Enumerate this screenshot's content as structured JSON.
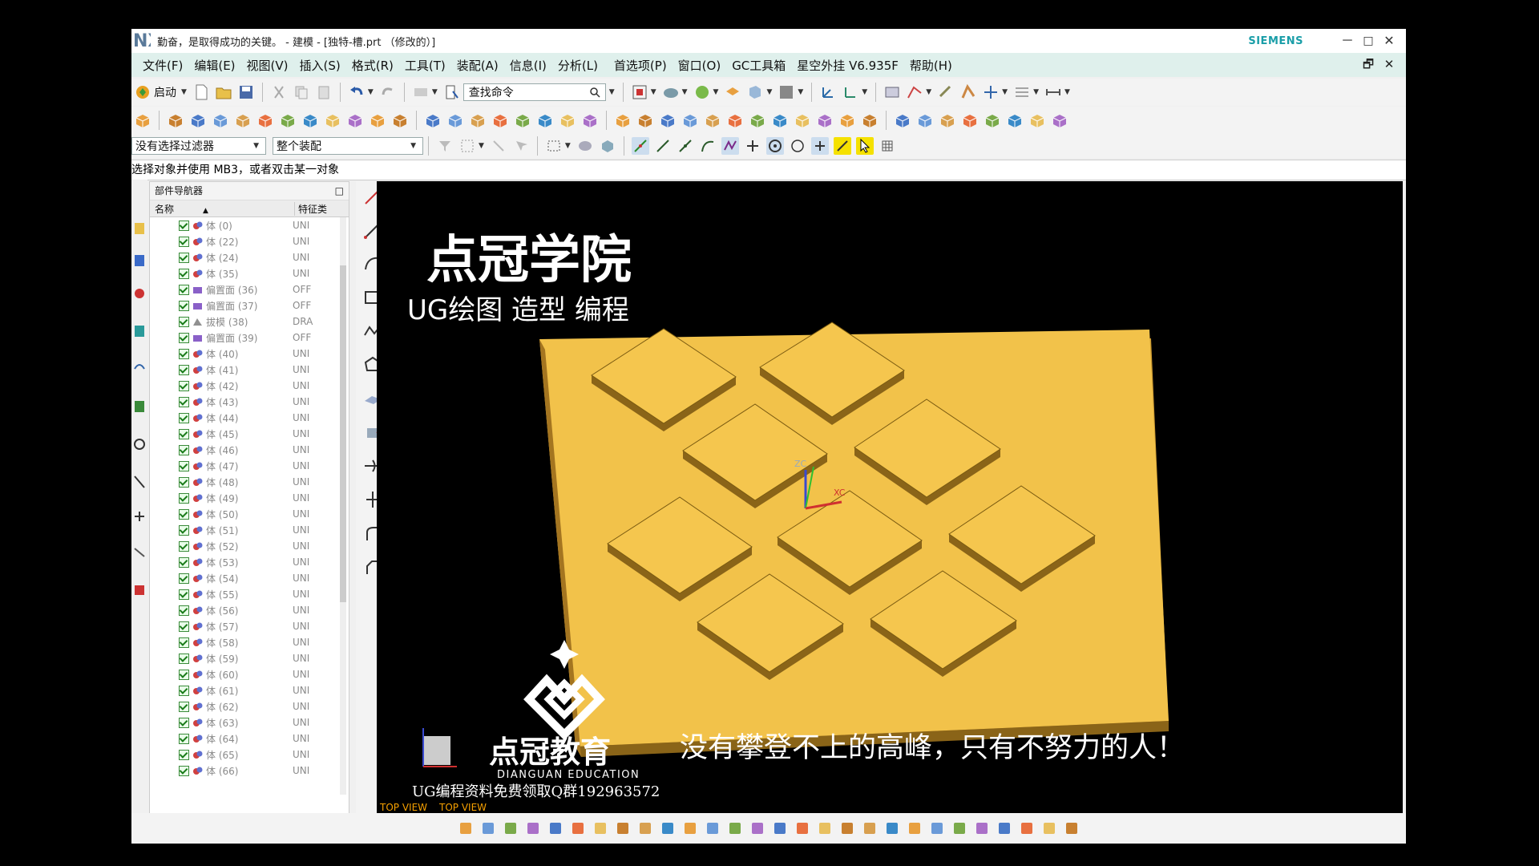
{
  "window": {
    "logo_text": "NX",
    "title": "勤奋，是取得成功的关键。 - 建模 - [独特-槽.prt （修改的）]",
    "brand": "SIEMENS",
    "minimize": "－",
    "maximize": "□",
    "close": "✕"
  },
  "menubar": {
    "items": [
      "文件(F)",
      "编辑(E)",
      "视图(V)",
      "插入(S)",
      "格式(R)",
      "工具(T)",
      "装配(A)",
      "信息(I)",
      "分析(L)",
      "首选项(P)",
      "窗口(O)",
      "GC工具箱",
      "星空外挂 V6.935F",
      "帮助(H)"
    ],
    "restore": "🗗",
    "close": "✕"
  },
  "toolbar": {
    "start_label": "启动",
    "search_placeholder": "查找命令",
    "filter_value": "没有选择过滤器",
    "scope_value": "整个装配"
  },
  "status": {
    "prompt": "选择对象并使用 MB3，或者双击某一对象"
  },
  "navigator": {
    "title": "部件导航器",
    "col_name": "名称",
    "col_type": "特征类",
    "rows": [
      {
        "label": "体 (0)",
        "type": "UNI",
        "kind": "body"
      },
      {
        "label": "体 (22)",
        "type": "UNI",
        "kind": "body"
      },
      {
        "label": "体 (24)",
        "type": "UNI",
        "kind": "body"
      },
      {
        "label": "体 (35)",
        "type": "UNI",
        "kind": "body"
      },
      {
        "label": "偏置面 (36)",
        "type": "OFF",
        "kind": "offset"
      },
      {
        "label": "偏置面 (37)",
        "type": "OFF",
        "kind": "offset"
      },
      {
        "label": "拔模 (38)",
        "type": "DRA",
        "kind": "draft"
      },
      {
        "label": "偏置面 (39)",
        "type": "OFF",
        "kind": "offset"
      },
      {
        "label": "体 (40)",
        "type": "UNI",
        "kind": "body"
      },
      {
        "label": "体 (41)",
        "type": "UNI",
        "kind": "body"
      },
      {
        "label": "体 (42)",
        "type": "UNI",
        "kind": "body"
      },
      {
        "label": "体 (43)",
        "type": "UNI",
        "kind": "body"
      },
      {
        "label": "体 (44)",
        "type": "UNI",
        "kind": "body"
      },
      {
        "label": "体 (45)",
        "type": "UNI",
        "kind": "body"
      },
      {
        "label": "体 (46)",
        "type": "UNI",
        "kind": "body"
      },
      {
        "label": "体 (47)",
        "type": "UNI",
        "kind": "body"
      },
      {
        "label": "体 (48)",
        "type": "UNI",
        "kind": "body"
      },
      {
        "label": "体 (49)",
        "type": "UNI",
        "kind": "body"
      },
      {
        "label": "体 (50)",
        "type": "UNI",
        "kind": "body"
      },
      {
        "label": "体 (51)",
        "type": "UNI",
        "kind": "body"
      },
      {
        "label": "体 (52)",
        "type": "UNI",
        "kind": "body"
      },
      {
        "label": "体 (53)",
        "type": "UNI",
        "kind": "body"
      },
      {
        "label": "体 (54)",
        "type": "UNI",
        "kind": "body"
      },
      {
        "label": "体 (55)",
        "type": "UNI",
        "kind": "body"
      },
      {
        "label": "体 (56)",
        "type": "UNI",
        "kind": "body"
      },
      {
        "label": "体 (57)",
        "type": "UNI",
        "kind": "body"
      },
      {
        "label": "体 (58)",
        "type": "UNI",
        "kind": "body"
      },
      {
        "label": "体 (59)",
        "type": "UNI",
        "kind": "body"
      },
      {
        "label": "体 (60)",
        "type": "UNI",
        "kind": "body"
      },
      {
        "label": "体 (61)",
        "type": "UNI",
        "kind": "body"
      },
      {
        "label": "体 (62)",
        "type": "UNI",
        "kind": "body"
      },
      {
        "label": "体 (63)",
        "type": "UNI",
        "kind": "body"
      },
      {
        "label": "体 (64)",
        "type": "UNI",
        "kind": "body"
      },
      {
        "label": "体 (65)",
        "type": "UNI",
        "kind": "body"
      },
      {
        "label": "体 (66)",
        "type": "UNI",
        "kind": "body"
      }
    ]
  },
  "viewport": {
    "overlay_title": "点冠学院",
    "overlay_subtitle": "UG绘图 造型 编程",
    "axis_z": "ZC",
    "axis_x": "XC",
    "brand_cn": "点冠教育",
    "brand_en": "DIANGUAN EDUCATION",
    "slogan": "没有攀登不上的高峰，只有不努力的人！",
    "promo": "UG编程资料免费领取Q群192963572",
    "view_label_1": "TOP VIEW",
    "view_label_2": "TOP VIEW",
    "part_color": "#f2c24a",
    "accent": "#f5b800"
  }
}
